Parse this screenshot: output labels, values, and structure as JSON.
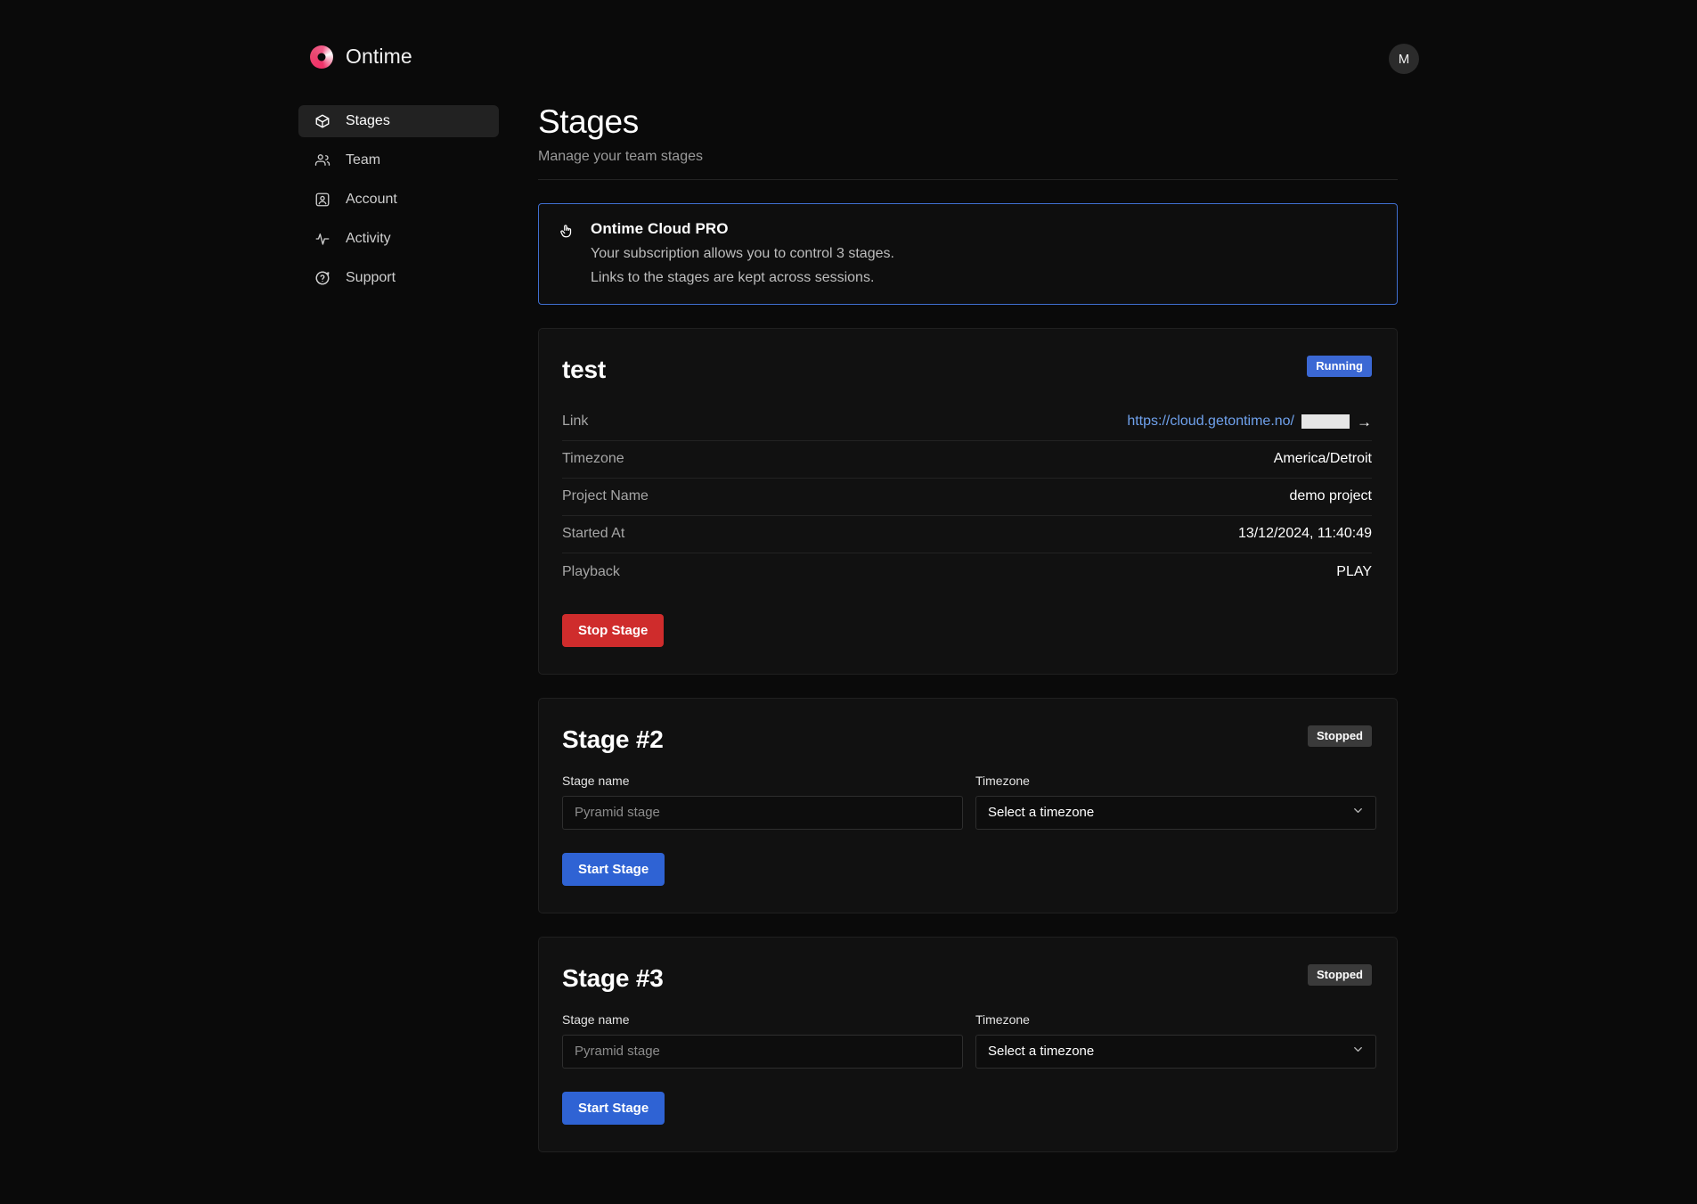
{
  "header": {
    "brand_name": "Ontime",
    "logo_icon": "ontime-logo-icon",
    "avatar_initial": "M"
  },
  "sidebar": {
    "items": [
      {
        "label": "Stages",
        "icon": "box-icon",
        "active": true
      },
      {
        "label": "Team",
        "icon": "users-icon",
        "active": false
      },
      {
        "label": "Account",
        "icon": "user-square-icon",
        "active": false
      },
      {
        "label": "Activity",
        "icon": "activity-pulse-icon",
        "active": false
      },
      {
        "label": "Support",
        "icon": "help-circle-icon",
        "active": false
      }
    ]
  },
  "page": {
    "title": "Stages",
    "subtitle": "Manage your team stages"
  },
  "banner": {
    "icon": "pointer-hand-icon",
    "title": "Ontime Cloud PRO",
    "line1": "Your subscription allows you to control 3 stages.",
    "line2": "Links to the stages are kept across sessions."
  },
  "stages": [
    {
      "name": "test",
      "status": "Running",
      "status_kind": "running",
      "details": [
        {
          "key": "Link",
          "value": "https://cloud.getontime.no/",
          "kind": "link"
        },
        {
          "key": "Timezone",
          "value": "America/Detroit",
          "kind": "text"
        },
        {
          "key": "Project Name",
          "value": "demo project",
          "kind": "text"
        },
        {
          "key": "Started At",
          "value": "13/12/2024, 11:40:49",
          "kind": "text"
        },
        {
          "key": "Playback",
          "value": "PLAY",
          "kind": "text"
        }
      ],
      "action_label": "Stop Stage",
      "action_kind": "danger"
    },
    {
      "name": "Stage #2",
      "status": "Stopped",
      "status_kind": "stopped",
      "form": {
        "name_label": "Stage name",
        "name_value": "",
        "name_placeholder": "Pyramid stage",
        "timezone_label": "Timezone",
        "timezone_value": "Select a timezone",
        "chevron_icon": "chevron-down-icon"
      },
      "action_label": "Start Stage",
      "action_kind": "primary"
    },
    {
      "name": "Stage #3",
      "status": "Stopped",
      "status_kind": "stopped",
      "form": {
        "name_label": "Stage name",
        "name_value": "",
        "name_placeholder": "Pyramid stage",
        "timezone_label": "Timezone",
        "timezone_value": "Select a timezone",
        "chevron_icon": "chevron-down-icon"
      },
      "action_label": "Start Stage",
      "action_kind": "primary"
    }
  ],
  "colors": {
    "background": "#0a0a0a",
    "card": "#111111",
    "accent_blue": "#3b68d4",
    "danger_red": "#cf2c2c",
    "link_blue": "#6fa1ec",
    "banner_border": "#3f6fd0"
  }
}
